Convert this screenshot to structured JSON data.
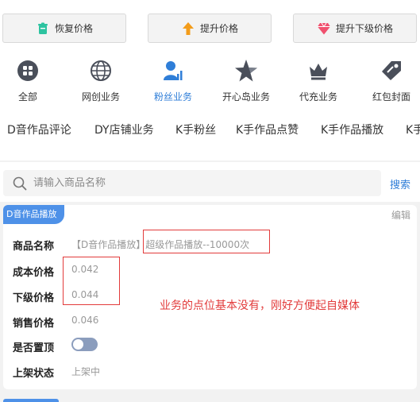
{
  "actions": {
    "restore_price": "恢复价格",
    "raise_price": "提升价格",
    "raise_lower_price": "提升下级价格"
  },
  "categories": [
    {
      "label": "全部",
      "icon": "grid-icon"
    },
    {
      "label": "网创业务",
      "icon": "globe-icon"
    },
    {
      "label": "粉丝业务",
      "icon": "user-chart-icon",
      "active": true
    },
    {
      "label": "开心岛业务",
      "icon": "star-icon"
    },
    {
      "label": "代充业务",
      "icon": "crown-icon"
    },
    {
      "label": "红包封面",
      "icon": "tag-icon"
    }
  ],
  "tabs": [
    "D音作品评论",
    "DY店铺业务",
    "K手粉丝",
    "K手作品点赞",
    "K手作品播放",
    "K手"
  ],
  "search": {
    "placeholder": "请输入商品名称",
    "button": "搜索"
  },
  "product": {
    "tag": "D音作品播放",
    "edit": "编辑",
    "name_label": "商品名称",
    "name_value": "【D音作品播放】超级作品播放--10000次",
    "cost_label": "成本价格",
    "cost_value": "0.042",
    "lower_label": "下级价格",
    "lower_value": "0.044",
    "sale_label": "销售价格",
    "sale_value": "0.046",
    "top_label": "是否置顶",
    "top_on": false,
    "status_label": "上架状态",
    "status_value": "上架中"
  },
  "annotation": "业务的点位基本没有，刚好方便起自媒体",
  "colors": {
    "accent": "#2f7ed8",
    "tag": "#4e91e8",
    "annotation": "#e23b3b"
  }
}
